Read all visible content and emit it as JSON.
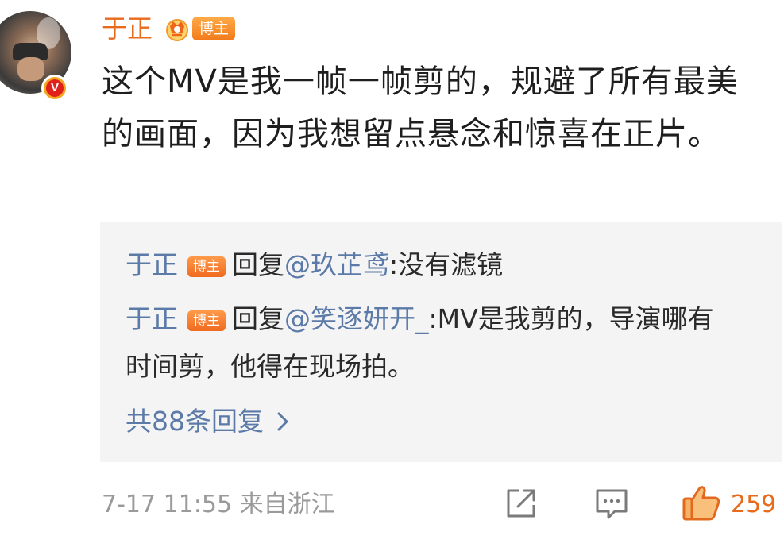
{
  "post": {
    "author": "于正",
    "badge": "博主",
    "text": "这个MV是我一帧一帧剪的，规避了所有最美的画面，因为我想留点悬念和惊喜在正片。"
  },
  "replies": [
    {
      "author": "于正",
      "badge": "博主",
      "verb": "回复",
      "mention": "@玖芷鸢",
      "text": ":没有滤镜"
    },
    {
      "author": "于正",
      "badge": "博主",
      "verb": "回复",
      "mention": "@笑逐妍开_",
      "text": ":MV是我剪的，导演哪有时间剪，他得在现场拍。"
    }
  ],
  "more_replies": "共88条回复",
  "footer": {
    "time_source": "7-17 11:55 来自浙江",
    "like_count": "259"
  },
  "colors": {
    "name_orange": "#e86a1b",
    "link_blue": "#5b7aa8",
    "reply_bg": "#f4f4f4",
    "meta_gray": "#9a9a9a"
  },
  "icons": [
    "avatar",
    "verified-v-icon",
    "crown-icon",
    "chevron-right-icon",
    "share-icon",
    "comment-icon",
    "like-icon"
  ]
}
